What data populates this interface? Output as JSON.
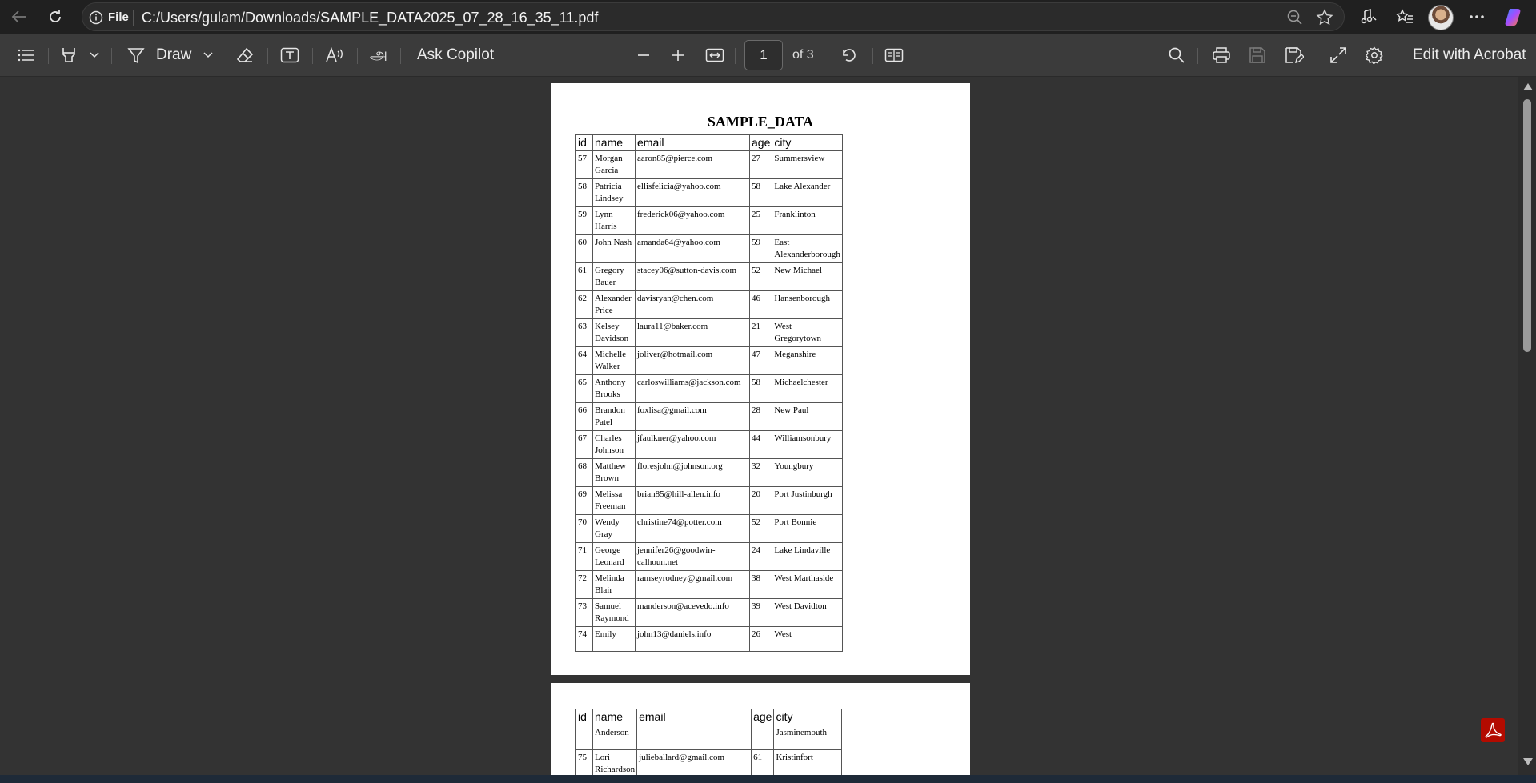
{
  "browser": {
    "address_label": "File",
    "url": "C:/Users/gulam/Downloads/SAMPLE_DATA2025_07_28_16_35_11.pdf"
  },
  "toolbar": {
    "draw_label": "Draw",
    "ask_copilot_label": "Ask Copilot",
    "page_number": "1",
    "page_total": "of 3",
    "edit_acrobat_label": "Edit with Acrobat"
  },
  "document": {
    "title": "SAMPLE_DATA",
    "headers": [
      "id",
      "name",
      "email",
      "age",
      "city"
    ],
    "page1_rows": [
      [
        "57",
        "Morgan Garcia",
        "aaron85@pierce.com",
        "27",
        "Summersview"
      ],
      [
        "58",
        "Patricia Lindsey",
        "ellisfelicia@yahoo.com",
        "58",
        "Lake Alexander"
      ],
      [
        "59",
        "Lynn Harris",
        "frederick06@yahoo.com",
        "25",
        "Franklinton"
      ],
      [
        "60",
        "John Nash",
        "amanda64@yahoo.com",
        "59",
        "East Alexanderborough"
      ],
      [
        "61",
        "Gregory Bauer",
        "stacey06@sutton-davis.com",
        "52",
        "New Michael"
      ],
      [
        "62",
        "Alexander Price",
        "davisryan@chen.com",
        "46",
        "Hansenborough"
      ],
      [
        "63",
        "Kelsey Davidson",
        "laura11@baker.com",
        "21",
        "West Gregorytown"
      ],
      [
        "64",
        "Michelle Walker",
        "joliver@hotmail.com",
        "47",
        "Meganshire"
      ],
      [
        "65",
        "Anthony Brooks",
        "carloswilliams@jackson.com",
        "58",
        "Michaelchester"
      ],
      [
        "66",
        "Brandon Patel",
        "foxlisa@gmail.com",
        "28",
        "New Paul"
      ],
      [
        "67",
        "Charles Johnson",
        "jfaulkner@yahoo.com",
        "44",
        "Williamsonbury"
      ],
      [
        "68",
        "Matthew Brown",
        "floresjohn@johnson.org",
        "32",
        "Youngbury"
      ],
      [
        "69",
        "Melissa Freeman",
        "brian85@hill-allen.info",
        "20",
        "Port Justinburgh"
      ],
      [
        "70",
        "Wendy Gray",
        "christine74@potter.com",
        "52",
        "Port Bonnie"
      ],
      [
        "71",
        "George Leonard",
        "jennifer26@goodwin-calhoun.net",
        "24",
        "Lake Lindaville"
      ],
      [
        "72",
        "Melinda Blair",
        "ramseyrodney@gmail.com",
        "38",
        "West Marthaside"
      ],
      [
        "73",
        "Samuel Raymond",
        "manderson@acevedo.info",
        "39",
        "West Davidton"
      ],
      [
        "74",
        "Emily",
        "john13@daniels.info",
        "26",
        "West"
      ]
    ],
    "page2_rows": [
      [
        "",
        "Anderson",
        "",
        "",
        "Jasminemouth"
      ],
      [
        "75",
        "Lori Richardson",
        "julieballard@gmail.com",
        "61",
        "Kristinfort"
      ]
    ]
  }
}
